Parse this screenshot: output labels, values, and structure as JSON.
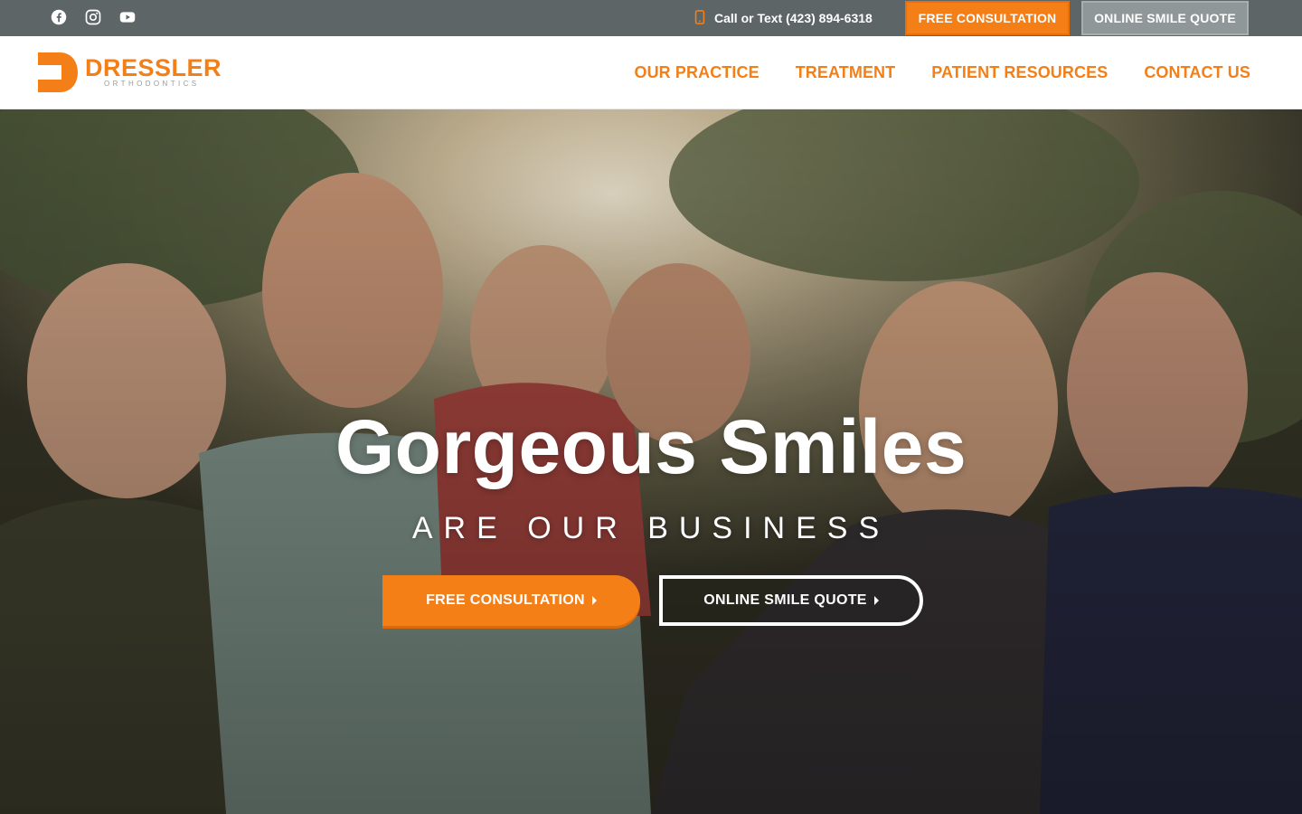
{
  "topbar": {
    "social": [
      {
        "icon": "facebook-icon"
      },
      {
        "icon": "instagram-icon"
      },
      {
        "icon": "youtube-icon"
      }
    ],
    "phone_text": "Call or Text (423) 894-6318",
    "consult_label": "FREE CONSULTATION",
    "quote_label": "ONLINE SMILE QUOTE"
  },
  "header": {
    "logo_word": "DRESSLER",
    "logo_sub": "ORTHODONTICS",
    "nav": [
      "OUR PRACTICE",
      "TREATMENT",
      "PATIENT RESOURCES",
      "CONTACT US"
    ]
  },
  "hero": {
    "title": "Gorgeous Smiles",
    "subtitle": "ARE OUR BUSINESS",
    "primary_cta": "FREE CONSULTATION",
    "secondary_cta": "ONLINE SMILE QUOTE"
  },
  "colors": {
    "brand_orange": "#f57f17",
    "topbar_gray": "#5d6567",
    "quote_gray": "#8f9799"
  }
}
